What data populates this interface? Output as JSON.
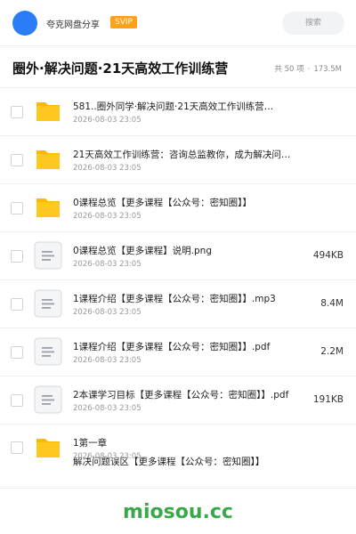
{
  "header": {
    "brand": "夸克网盘分享",
    "badge": "SVIP",
    "search_placeholder": "搜索"
  },
  "folder": {
    "title": "圈外·解决问题·21天高效工作训练营",
    "count": "共 50 项",
    "separator": "·",
    "total_size": "173.5M"
  },
  "items": [
    {
      "type": "folder",
      "name": "581..圈外同学·解决问题·21天高效工作训练营…",
      "date": "2026-08-03 23:05",
      "size": ""
    },
    {
      "type": "folder",
      "name": "21天高效工作训练营：咨询总监教你，成为解决问题的…",
      "date": "2026-08-03 23:05",
      "size": ""
    },
    {
      "type": "folder",
      "name": "0课程总览【更多课程【公众号：密知圈】】",
      "date": "2026-08-03 23:05",
      "size": ""
    },
    {
      "type": "file",
      "name": "0课程总览【更多课程】说明.png",
      "date": "2026-08-03 23:05",
      "size": "494KB"
    },
    {
      "type": "file",
      "name": "1课程介绍【更多课程【公众号：密知圈】】.mp3",
      "date": "2026-08-03 23:05",
      "size": "8.4M"
    },
    {
      "type": "file",
      "name": "1课程介绍【更多课程【公众号：密知圈】】.pdf",
      "date": "2026-08-03 23:05",
      "size": "2.2M"
    },
    {
      "type": "file",
      "name": "2本课学习目标【更多课程【公众号：密知圈】】.pdf",
      "date": "2026-08-03 23:05",
      "size": "191KB"
    },
    {
      "type": "folder",
      "name": "1第一章",
      "name_line2": "解决问题误区【更多课程【公众号：密知圈】】",
      "date": "2026-08-03 23:05",
      "size": ""
    }
  ],
  "footer": {
    "watermark": "miosou.cc"
  },
  "colors": {
    "accent": "#2b7cf7",
    "badge": "#ff9f1a",
    "folder": "#ffc81e",
    "watermark": "#3aa84a"
  }
}
